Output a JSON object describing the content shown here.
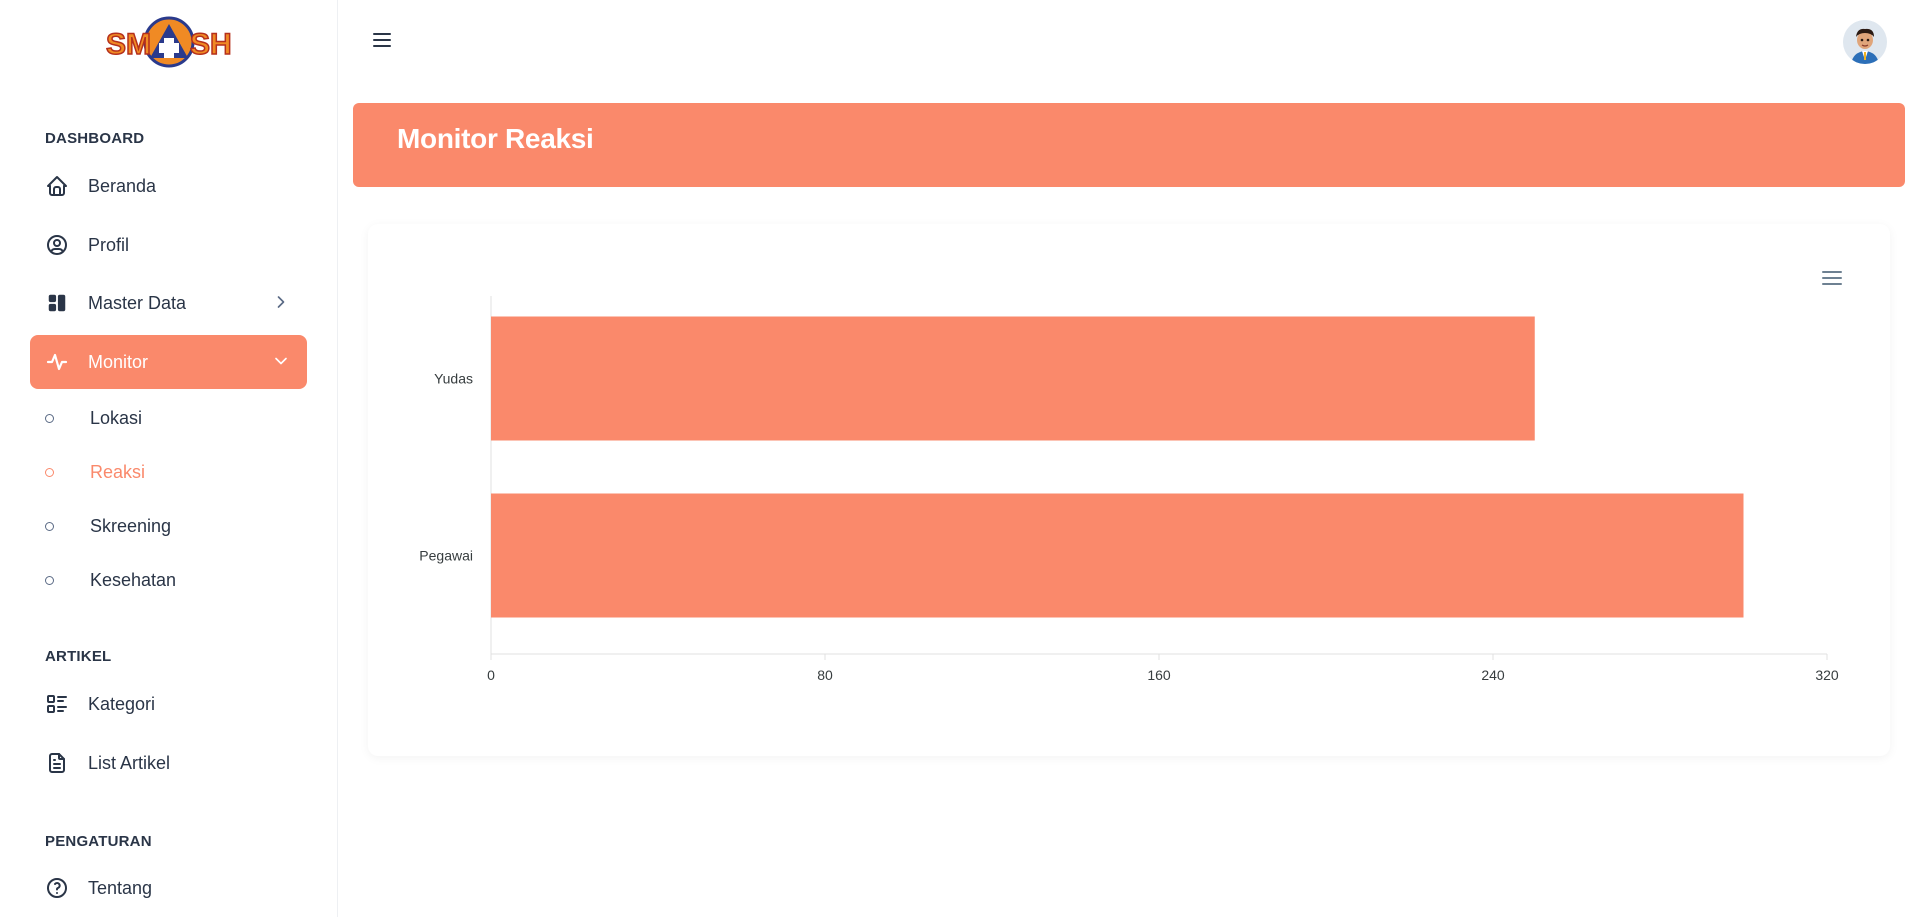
{
  "app": {
    "logo_text": "SMASH"
  },
  "sidebar": {
    "sections": [
      {
        "title": "DASHBOARD"
      },
      {
        "title": "ARTIKEL"
      },
      {
        "title": "PENGATURAN"
      }
    ],
    "items": [
      {
        "label": "Beranda",
        "icon": "home-icon"
      },
      {
        "label": "Profil",
        "icon": "user-circle-icon"
      },
      {
        "label": "Master Data",
        "icon": "layout-dashboard-icon"
      },
      {
        "label": "Monitor",
        "icon": "activity-icon"
      },
      {
        "label": "Kategori",
        "icon": "list-details-icon"
      },
      {
        "label": "List Artikel",
        "icon": "file-text-icon"
      },
      {
        "label": "Tentang",
        "icon": "help-circle-icon"
      }
    ],
    "monitor_sub": [
      {
        "label": "Lokasi"
      },
      {
        "label": "Reaksi"
      },
      {
        "label": "Skreening"
      },
      {
        "label": "Kesehatan"
      }
    ]
  },
  "header": {
    "title": "Monitor Reaksi"
  },
  "colors": {
    "accent": "#fa896b",
    "text": "#2a3547"
  },
  "chart_data": {
    "type": "bar",
    "orientation": "horizontal",
    "categories": [
      "Yudas",
      "Pegawai"
    ],
    "values": [
      250,
      300
    ],
    "xlim": [
      0,
      320
    ],
    "x_ticks": [
      0,
      80,
      160,
      240,
      320
    ],
    "color": "#fa896b"
  }
}
